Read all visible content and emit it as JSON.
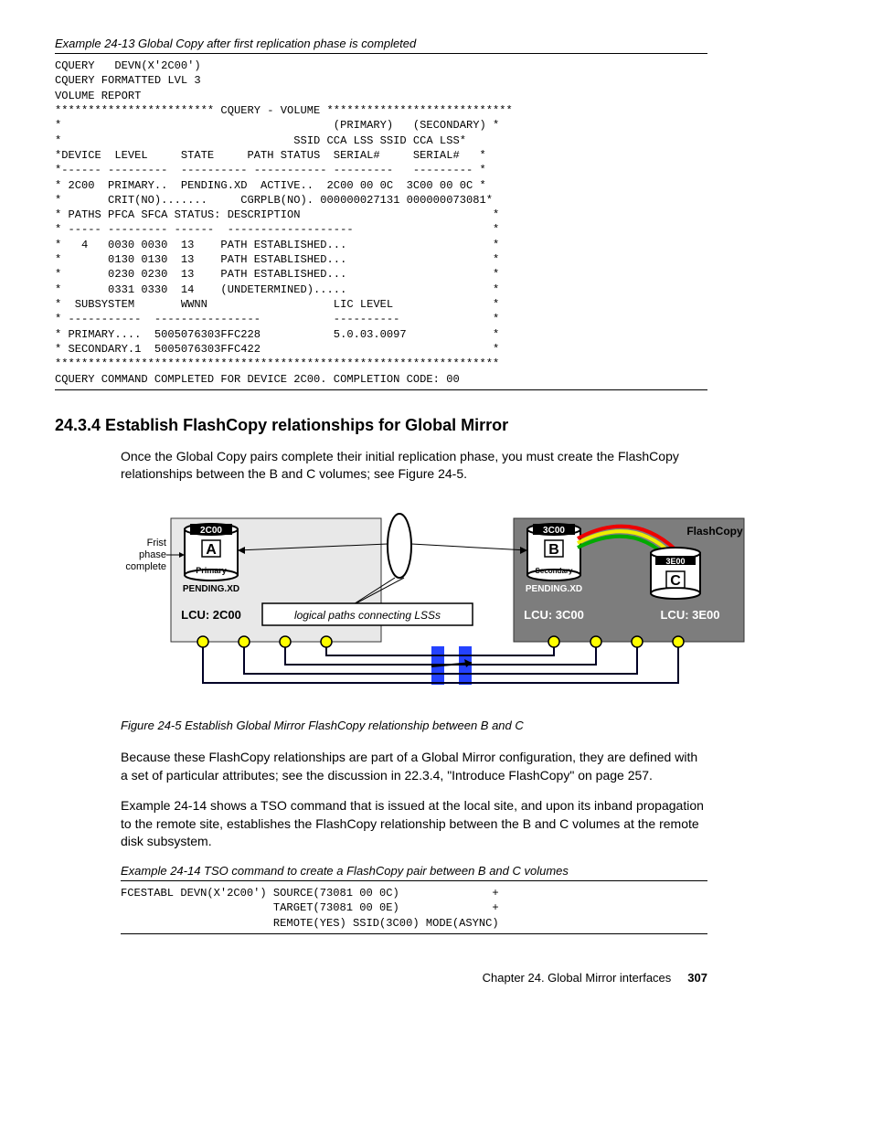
{
  "example13": {
    "caption": "Example 24-13   Global Copy after first replication phase is completed",
    "code": "CQUERY   DEVN(X'2C00')\nCQUERY FORMATTED LVL 3\nVOLUME REPORT\n************************ CQUERY - VOLUME ****************************\n*                                         (PRIMARY)   (SECONDARY) *\n*                                   SSID CCA LSS SSID CCA LSS*\n*DEVICE  LEVEL     STATE     PATH STATUS  SERIAL#     SERIAL#   *\n*------ ---------  ---------- ----------- ---------   --------- *\n* 2C00  PRIMARY..  PENDING.XD  ACTIVE..  2C00 00 0C  3C00 00 0C *\n*       CRIT(NO).......     CGRPLB(NO). 000000027131 000000073081*\n* PATHS PFCA SFCA STATUS: DESCRIPTION                             *\n* ----- --------- ------  -------------------                     *\n*   4   0030 0030  13    PATH ESTABLISHED...                      *\n*       0130 0130  13    PATH ESTABLISHED...                      *\n*       0230 0230  13    PATH ESTABLISHED...                      *\n*       0331 0330  14    (UNDETERMINED).....                      *\n*  SUBSYSTEM       WWNN                   LIC LEVEL               *\n* -----------  ----------------           ----------              *\n* PRIMARY....  5005076303FFC228           5.0.03.0097             *\n* SECONDARY.1  5005076303FFC422                                   *\n*******************************************************************\nCQUERY COMMAND COMPLETED FOR DEVICE 2C00. COMPLETION CODE: 00"
  },
  "section": {
    "heading": "24.3.4  Establish FlashCopy relationships for Global Mirror",
    "para1": "Once the Global Copy pairs complete their initial replication phase, you must create the FlashCopy relationships between the B and C volumes; see Figure 24-5.",
    "figcaption": "Figure 24-5   Establish Global Mirror FlashCopy relationship between B and C",
    "para2": "Because these FlashCopy relationships are part of a Global Mirror configuration, they are defined with a set of particular attributes; see the discussion in 22.3.4, \"Introduce FlashCopy\" on page 257.",
    "para3": "Example 24-14 shows a TSO command that is issued at the local site, and upon its inband propagation to the remote site, establishes the FlashCopy relationship between the B and C volumes at the remote disk subsystem."
  },
  "figure": {
    "left_note": [
      "Frist",
      "phase",
      "complete"
    ],
    "volA": {
      "id": "2C00",
      "letter": "A",
      "role": "Primary",
      "state": "PENDING.XD",
      "lcu": "LCU: 2C00"
    },
    "volB": {
      "id": "3C00",
      "letter": "B",
      "role": "Secondary",
      "state": "PENDING.XD",
      "lcu": "LCU: 3C00"
    },
    "volC": {
      "id": "3E00",
      "letter": "C",
      "lcu": "LCU: 3E00"
    },
    "middle": "logical paths connecting LSSs",
    "flashcopy": "FlashCopy"
  },
  "example14": {
    "caption": "Example 24-14   TSO command to create a FlashCopy pair between B and C volumes",
    "code": "FCESTABL DEVN(X'2C00') SOURCE(73081 00 0C)              +\n                       TARGET(73081 00 0E)              +\n                       REMOTE(YES) SSID(3C00) MODE(ASYNC)"
  },
  "footer": {
    "chapter": "Chapter 24. Global Mirror interfaces",
    "page": "307"
  }
}
